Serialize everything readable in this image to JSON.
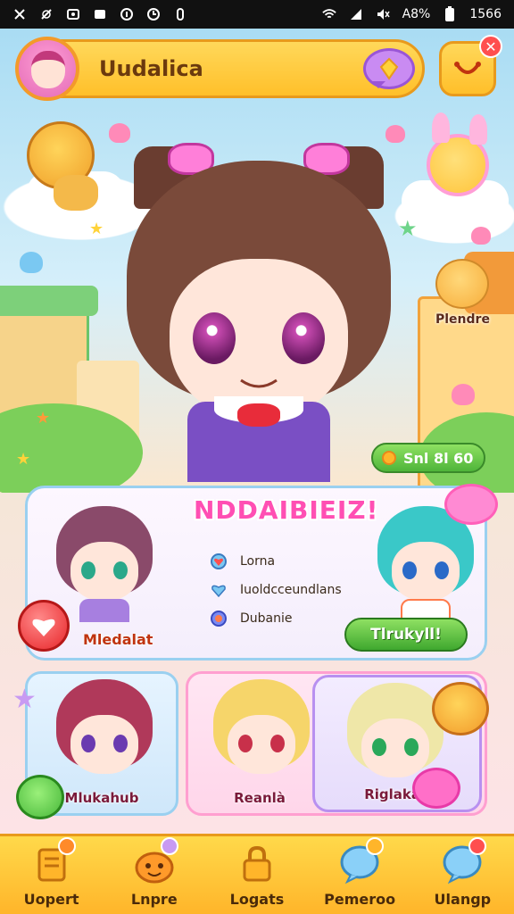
{
  "status_bar": {
    "battery": "A8%",
    "time": "1566"
  },
  "header": {
    "title": "Uudalica"
  },
  "scene": {
    "side_label": "Plendre",
    "score": "Snl 8l 60"
  },
  "team_card": {
    "title": "NDDAIBIEIZ!",
    "left_member_name": "Mledalat",
    "stats": [
      {
        "icon": "heart-shield-icon",
        "label": "Lorna"
      },
      {
        "icon": "heart-icon",
        "label": "Iuoldcceundlans"
      },
      {
        "icon": "gem-icon",
        "label": "Dubanie"
      }
    ],
    "action_button": "Tlrukyll!"
  },
  "characters": [
    {
      "name": "Mlukahub"
    },
    {
      "name": "Reanlà"
    },
    {
      "name": "Riglakab"
    }
  ],
  "bottom_nav": [
    {
      "label": "Uopert",
      "icon": "trophy-icon"
    },
    {
      "label": "Lnpre",
      "icon": "pet-icon"
    },
    {
      "label": "Logats",
      "icon": "lock-icon"
    },
    {
      "label": "Pemeroo",
      "icon": "balloon-icon"
    },
    {
      "label": "Ulangp",
      "icon": "check-bubble-icon"
    }
  ],
  "colors": {
    "accent_yellow": "#ffc02a",
    "accent_pink": "#ff4fb3",
    "accent_green": "#4fb53a"
  }
}
